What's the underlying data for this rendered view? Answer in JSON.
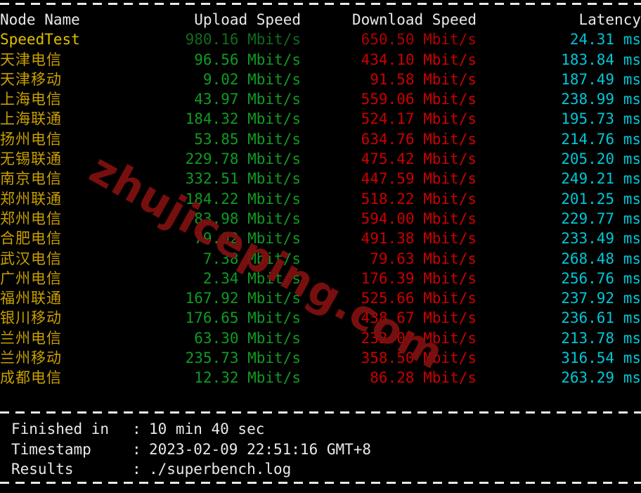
{
  "theme": {
    "background": "#000000",
    "header_color": "#e8e8e8",
    "node_color": "#c8a000",
    "upload_color": "#0f9c22",
    "download_color": "#cc0000",
    "latency_color": "#00c8d7",
    "rule_color": "#e8e8e8",
    "watermark_color": "#7e1010"
  },
  "watermark": {
    "text": "zhujiceping.com"
  },
  "table": {
    "headers": {
      "node": "Node Name",
      "upload": "Upload Speed",
      "download": "Download Speed",
      "latency": "Latency"
    },
    "rows": [
      {
        "node": "SpeedTest",
        "upload": "980.16 Mbit/s",
        "download": "650.50 Mbit/s",
        "latency": "24.31 ms",
        "highlight": true
      },
      {
        "node": "天津电信",
        "upload": "96.56 Mbit/s",
        "download": "434.10 Mbit/s",
        "latency": "183.84 ms",
        "highlight": false
      },
      {
        "node": "天津移动",
        "upload": "9.02 Mbit/s",
        "download": "91.58 Mbit/s",
        "latency": "187.49 ms",
        "highlight": false
      },
      {
        "node": "上海电信",
        "upload": "43.97 Mbit/s",
        "download": "559.06 Mbit/s",
        "latency": "238.99 ms",
        "highlight": false
      },
      {
        "node": "上海联通",
        "upload": "184.32 Mbit/s",
        "download": "524.17 Mbit/s",
        "latency": "195.73 ms",
        "highlight": false
      },
      {
        "node": "扬州电信",
        "upload": "53.85 Mbit/s",
        "download": "634.76 Mbit/s",
        "latency": "214.76 ms",
        "highlight": false
      },
      {
        "node": "无锡联通",
        "upload": "229.78 Mbit/s",
        "download": "475.42 Mbit/s",
        "latency": "205.20 ms",
        "highlight": false
      },
      {
        "node": "南京电信",
        "upload": "332.51 Mbit/s",
        "download": "447.59 Mbit/s",
        "latency": "249.21 ms",
        "highlight": false
      },
      {
        "node": "郑州联通",
        "upload": "184.22 Mbit/s",
        "download": "518.22 Mbit/s",
        "latency": "201.25 ms",
        "highlight": false
      },
      {
        "node": "郑州电信",
        "upload": "83.98 Mbit/s",
        "download": "594.00 Mbit/s",
        "latency": "229.77 ms",
        "highlight": false
      },
      {
        "node": "合肥电信",
        "upload": "79.92 Mbit/s",
        "download": "491.38 Mbit/s",
        "latency": "233.49 ms",
        "highlight": false
      },
      {
        "node": "武汉电信",
        "upload": "7.38 Mbit/s",
        "download": "79.63 Mbit/s",
        "latency": "268.48 ms",
        "highlight": false
      },
      {
        "node": "广州电信",
        "upload": "2.34 Mbit/s",
        "download": "176.39 Mbit/s",
        "latency": "256.76 ms",
        "highlight": false
      },
      {
        "node": "福州联通",
        "upload": "167.92 Mbit/s",
        "download": "525.66 Mbit/s",
        "latency": "237.92 ms",
        "highlight": false
      },
      {
        "node": "银川移动",
        "upload": "176.65 Mbit/s",
        "download": "438.67 Mbit/s",
        "latency": "236.61 ms",
        "highlight": false
      },
      {
        "node": "兰州电信",
        "upload": "63.30 Mbit/s",
        "download": "232.07 Mbit/s",
        "latency": "213.78 ms",
        "highlight": false
      },
      {
        "node": "兰州移动",
        "upload": "235.73 Mbit/s",
        "download": "358.50 Mbit/s",
        "latency": "316.54 ms",
        "highlight": false
      },
      {
        "node": "成都电信",
        "upload": "12.32 Mbit/s",
        "download": "86.28 Mbit/s",
        "latency": "263.29 ms",
        "highlight": false
      }
    ]
  },
  "footer": {
    "rows": [
      {
        "key": "Finished in",
        "colon": ":",
        "value": "10 min 40 sec"
      },
      {
        "key": "Timestamp",
        "colon": ":",
        "value": "2023-02-09 22:51:16 GMT+8"
      },
      {
        "key": "Results",
        "colon": ":",
        "value": "./superbench.log"
      }
    ]
  }
}
